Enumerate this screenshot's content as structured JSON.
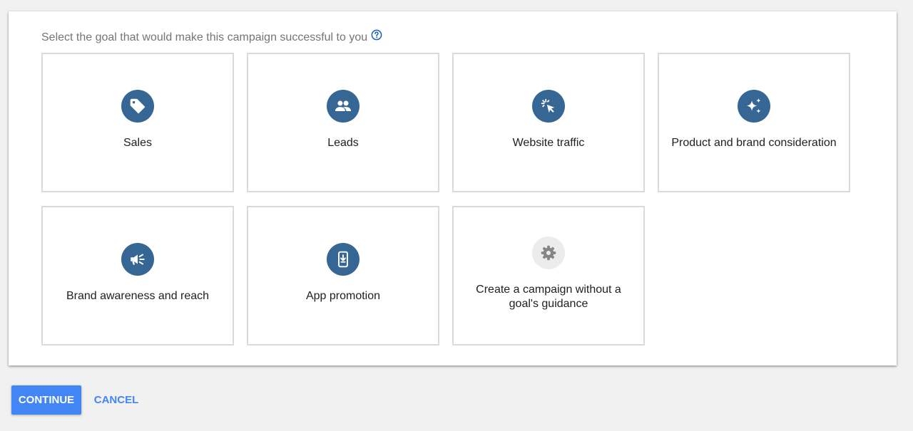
{
  "prompt": {
    "text": "Select the goal that would make this campaign successful to you",
    "help_icon": "help-circle-icon"
  },
  "goals": [
    {
      "label": "Sales",
      "icon": "tag-icon"
    },
    {
      "label": "Leads",
      "icon": "people-icon"
    },
    {
      "label": "Website traffic",
      "icon": "cursor-click-icon"
    },
    {
      "label": "Product and brand consideration",
      "icon": "sparkle-icon"
    },
    {
      "label": "Brand awareness and reach",
      "icon": "megaphone-icon"
    },
    {
      "label": "App promotion",
      "icon": "phone-download-icon"
    },
    {
      "label": "Create a campaign without a goal's guidance",
      "icon": "gear-icon"
    }
  ],
  "actions": {
    "continue_label": "CONTINUE",
    "cancel_label": "CANCEL"
  },
  "colors": {
    "icon_circle": "#356694",
    "icon_circle_neutral": "#ececec",
    "primary_button": "#4285f4",
    "tile_border": "#dadada",
    "page_background": "#f1f1f1"
  }
}
